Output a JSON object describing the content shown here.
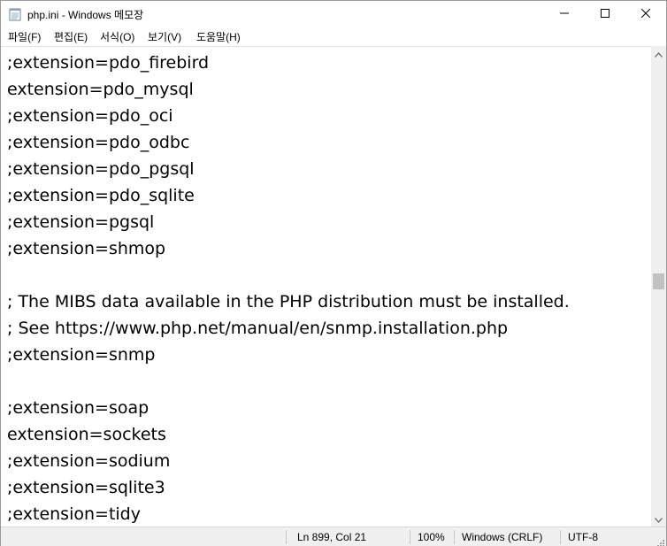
{
  "window": {
    "title": "php.ini - Windows 메모장",
    "app_icon": "notepad-icon",
    "controls": {
      "minimize_icon": "minimize-icon",
      "maximize_icon": "maximize-icon",
      "close_icon": "close-icon"
    }
  },
  "menu": {
    "items": [
      {
        "label": "파일(F)"
      },
      {
        "label": "편집(E)"
      },
      {
        "label": "서식(O)"
      },
      {
        "label": "보기(V)"
      },
      {
        "label": "도움말(H)"
      }
    ]
  },
  "editor": {
    "lines": [
      ";extension=pdo_firebird",
      "extension=pdo_mysql",
      ";extension=pdo_oci",
      ";extension=pdo_odbc",
      ";extension=pdo_pgsql",
      ";extension=pdo_sqlite",
      ";extension=pgsql",
      ";extension=shmop",
      "",
      "; The MIBS data available in the PHP distribution must be installed.",
      "; See https://www.php.net/manual/en/snmp.installation.php",
      ";extension=snmp",
      "",
      ";extension=soap",
      "extension=sockets",
      ";extension=sodium",
      ";extension=sqlite3",
      ";extension=tidy"
    ]
  },
  "statusbar": {
    "position": "Ln 899, Col 21",
    "zoom": "100%",
    "line_ending": "Windows (CRLF)",
    "encoding": "UTF-8"
  },
  "colors": {
    "background": "#ffffff",
    "chrome": "#f0f0f0",
    "scroll_thumb": "#c1c1c1"
  }
}
